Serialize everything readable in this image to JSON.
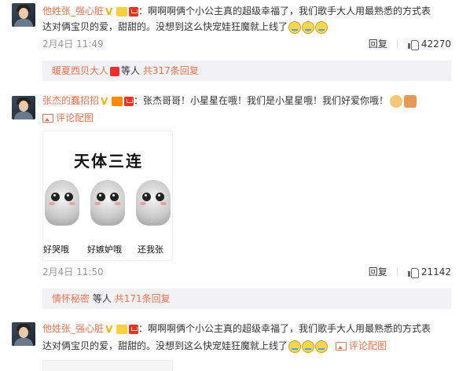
{
  "comments": [
    {
      "username": "他姓张_强心脏",
      "text_line1": "：啊啊啊俩个小公主真的超级幸福了，我们歌手大人用最熟悉的方式表",
      "text_line2": "达对俩宝贝的爱，甜甜的。没想到这么快宠娃狂魔就上线了",
      "time": "2月4日 11:49",
      "reply_label": "回复",
      "like_count": "42270",
      "sub": {
        "user": "暖夏西贝大人",
        "mid": "等人",
        "count_link": "共317条回复"
      }
    },
    {
      "username": "张杰的蠢招招",
      "text_line1": "：张杰哥哥！小星星在哦！我们是小星星哦！我们好爱你哦！",
      "pic_link": "评论配图",
      "sticker": {
        "title": "天体三连",
        "captions": [
          "好哭哦",
          "好嫉妒哦",
          "还我张"
        ]
      },
      "time": "2月4日 11:50",
      "reply_label": "回复",
      "like_count": "21142",
      "sub": {
        "user": "情怀秘密",
        "mid": "等人",
        "count_link": "共171条回复"
      }
    },
    {
      "username": "他姓张_强心脏",
      "text_line1": "：啊啊啊俩个小公主真的超级幸福了，我们歌手大人用最熟悉的方式表",
      "text_line2": "达对俩宝贝的爱，甜甜的。没想到这么快宠娃狂魔就上线了",
      "pic_link": "评论配图"
    }
  ],
  "colors": {
    "username": "#eb7350",
    "text": "#333333",
    "meta": "#999999",
    "subbox_bg": "#f2f2f5"
  },
  "icons": [
    "avatar",
    "verified-v-icon",
    "member-badge-icon",
    "red-envelope-badge-icon",
    "crying-emoji-icon",
    "thumb-up-icon",
    "picture-icon"
  ]
}
